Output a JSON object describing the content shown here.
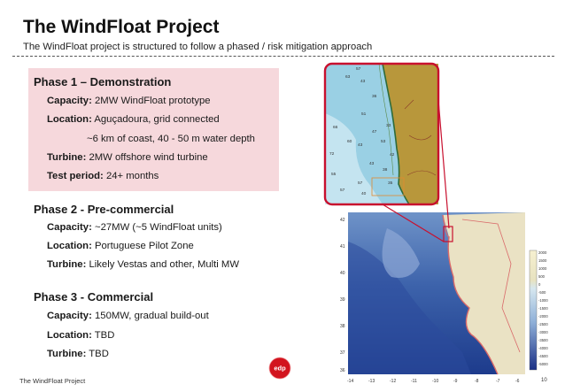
{
  "header": {
    "title": "The WindFloat Project",
    "subtitle": "The WindFloat project is structured to follow a phased / risk mitigation approach"
  },
  "phases": [
    {
      "heading": "Phase 1 – Demonstration",
      "lines": [
        {
          "label": "Capacity:",
          "value": "2MW WindFloat prototype"
        },
        {
          "label": "Location:",
          "value": "Aguçadoura, grid connected"
        },
        {
          "label": "",
          "value": "~6 km of coast, 40 - 50 m water depth"
        },
        {
          "label": "Turbine:",
          "value": "2MW offshore wind turbine"
        },
        {
          "label": "Test period:",
          "value": "24+ months"
        }
      ]
    },
    {
      "heading": "Phase 2 - Pre-commercial",
      "lines": [
        {
          "label": "Capacity:",
          "value": "~27MW  (~5 WindFloat units)"
        },
        {
          "label": "Location:",
          "value": "Portuguese Pilot Zone"
        },
        {
          "label": "Turbine:",
          "value": "Likely Vestas and other, Multi MW"
        }
      ]
    },
    {
      "heading": "Phase 3 - Commercial",
      "lines": [
        {
          "label": "Capacity:",
          "value": "150MW, gradual build-out"
        },
        {
          "label": "Location:",
          "value": "TBD"
        },
        {
          "label": "Turbine:",
          "value": "TBD"
        }
      ]
    }
  ],
  "footer": {
    "text": "The WindFloat Project",
    "logo_text": "edp",
    "page": "10"
  },
  "map": {
    "inset_depths": [
      "57",
      "63",
      "43",
      "66",
      "60",
      "47",
      "51",
      "72",
      "36",
      "43",
      "53",
      "57",
      "33",
      "43",
      "40",
      "42",
      "38",
      "35",
      "57",
      "55"
    ],
    "lat_ticks": [
      "42",
      "41",
      "40",
      "39",
      "38",
      "37",
      "36"
    ],
    "lon_ticks": [
      "-14",
      "-13",
      "-12",
      "-11",
      "-10",
      "-9",
      "-8",
      "-7",
      "-6"
    ],
    "scale_ticks": [
      "2000",
      "1500",
      "1000",
      "500",
      "0",
      "-500",
      "-1000",
      "-1500",
      "-2000",
      "-2500",
      "-3000",
      "-3500",
      "-4000",
      "-4500",
      "-5000"
    ],
    "colors": {
      "land": "#b8973b",
      "sea_shallow": "#9ad0e4",
      "frame": "#c8102e",
      "sea_deep": "#1d3b8c"
    }
  }
}
